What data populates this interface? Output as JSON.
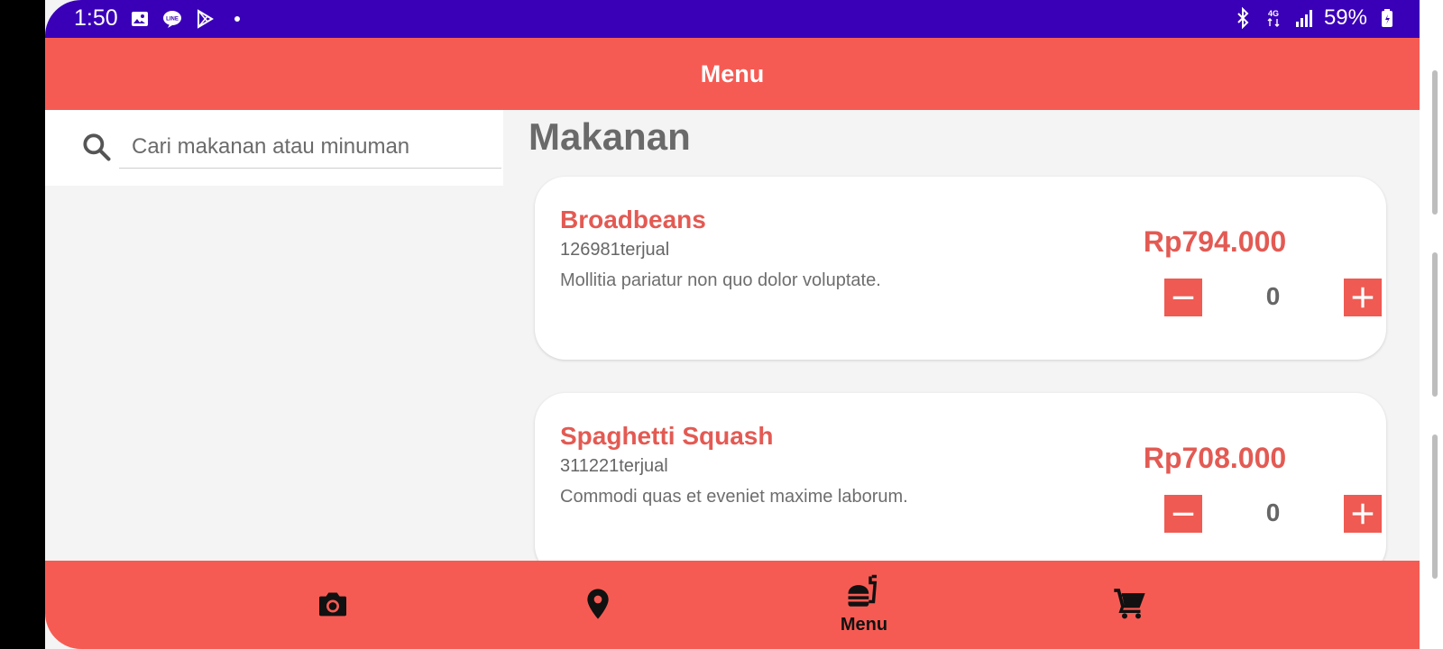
{
  "status_bar": {
    "time": "1:50",
    "battery": "59%",
    "icons": [
      "image-icon",
      "line-icon",
      "play-store-icon",
      "dot-icon",
      "bluetooth-icon",
      "4g-icon",
      "signal-icon",
      "battery-icon"
    ]
  },
  "app_bar": {
    "title": "Menu"
  },
  "search": {
    "placeholder": "Cari makanan atau minuman"
  },
  "section": {
    "title": "Makanan"
  },
  "items": [
    {
      "name": "Broadbeans",
      "sold": "126981terjual",
      "description": "Mollitia pariatur non quo dolor voluptate.",
      "price": "Rp794.000",
      "quantity": "0"
    },
    {
      "name": "Spaghetti Squash",
      "sold": "311221terjual",
      "description": "Commodi quas et eveniet maxime laborum.",
      "price": "Rp708.000",
      "quantity": "0"
    }
  ],
  "bottom_nav": {
    "items": [
      {
        "icon": "camera-icon",
        "label": ""
      },
      {
        "icon": "location-pin-icon",
        "label": ""
      },
      {
        "icon": "fastfood-icon",
        "label": "Menu"
      },
      {
        "icon": "cart-icon",
        "label": ""
      }
    ]
  },
  "colors": {
    "status_bar": "#3a00b8",
    "accent": "#f65b53",
    "price_text": "#e35a53",
    "background": "#f4f4f4"
  }
}
